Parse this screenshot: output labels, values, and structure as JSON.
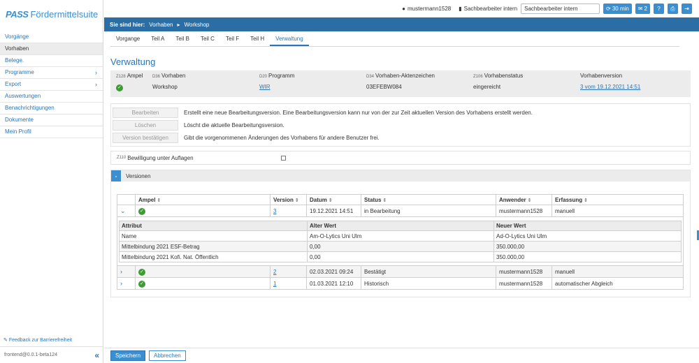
{
  "brand": {
    "pass": "PASS",
    "name": "Fördermittelsuite"
  },
  "sidebar": {
    "items": [
      {
        "label": "Vorgänge",
        "active": false,
        "chevron": false
      },
      {
        "label": "Vorhaben",
        "active": true,
        "chevron": false
      },
      {
        "label": "Belege.",
        "active": false,
        "chevron": false
      },
      {
        "label": "Programme",
        "active": false,
        "chevron": true
      },
      {
        "label": "Export",
        "active": false,
        "chevron": true
      },
      {
        "label": "Auswertungen",
        "active": false,
        "chevron": false
      },
      {
        "label": "Benachrichtigungen",
        "active": false,
        "chevron": false
      },
      {
        "label": "Dokumente",
        "active": false,
        "chevron": false
      },
      {
        "label": "Mein Profil",
        "active": false,
        "chevron": false
      }
    ],
    "feedback": "Feedback zur Barrierefreiheit",
    "version": "frontend@0.0.1-beta124"
  },
  "topbar": {
    "user": "mustermann1528",
    "role_label": "Sachbearbeiter intern",
    "role_select": "Sachbearbeiter intern",
    "session": "30 min",
    "messages": "2"
  },
  "breadcrumb": {
    "prefix": "Sie sind hier:",
    "items": [
      "Vorhaben",
      "Workshop"
    ]
  },
  "tabs": [
    "Vorgange",
    "Teil A",
    "Teil B",
    "Teil C",
    "Teil F",
    "Teil H",
    "Verwaltung"
  ],
  "page_title": "Verwaltung",
  "info": {
    "ampel": {
      "code": "Z128",
      "label": "Ampel"
    },
    "vorhaben": {
      "code": "D36",
      "label": "Vorhaben",
      "value": "Workshop"
    },
    "programm": {
      "code": "D20",
      "label": "Programm",
      "value": "WIR"
    },
    "aktenzeichen": {
      "code": "D34",
      "label": "Vorhaben-Aktenzeichen",
      "value": "03EFEBW084"
    },
    "status": {
      "code": "Z106",
      "label": "Vorhabenstatus",
      "value": "eingereicht"
    },
    "version": {
      "label": "Vorhabenversion",
      "value": "3 vom 19.12.2021 14:51"
    }
  },
  "actions": [
    {
      "button": "Bearbeiten",
      "desc": "Erstellt eine neue Bearbeitungsversion. Eine Bearbeitungsversion kann nur von der zur Zeit aktuellen Version des Vorhabens erstellt werden."
    },
    {
      "button": "Löschen",
      "desc": "Löscht die aktuelle Bearbeitungsversion."
    },
    {
      "button": "Version bestätigen",
      "desc": "Gibt die vorgenommenen Änderungen des Vorhabens für andere Benutzer frei."
    }
  ],
  "approval": {
    "code": "Z110",
    "label": "Bewilligung unter Auflagen"
  },
  "versions": {
    "title": "Versionen",
    "toggle": "-",
    "headers": [
      "Ampel",
      "Version",
      "Datum",
      "Status",
      "Anwender",
      "Erfassung"
    ],
    "rows": [
      {
        "version": "3",
        "datum": "19.12.2021 14:51",
        "status": "in Bearbeitung",
        "anwender": "mustermann1528",
        "erfassung": "manuell"
      },
      {
        "version": "2",
        "datum": "02.03.2021 09:24",
        "status": "Bestätigt",
        "anwender": "mustermann1528",
        "erfassung": "manuell"
      },
      {
        "version": "1",
        "datum": "01.03.2021 12:10",
        "status": "Historisch",
        "anwender": "mustermann1528",
        "erfassung": "automatischer Abgleich"
      }
    ],
    "detail": {
      "headers": [
        "Attribut",
        "Alter Wert",
        "Neuer Wert"
      ],
      "rows": [
        [
          "Name",
          "Am-O-Lytics Uni Ulm",
          "Ad-O-Lytics Uni Ulm"
        ],
        [
          "Mittelbindung 2021 ESF-Betrag",
          "0,00",
          "350.000,00"
        ],
        [
          "Mittelbindung 2021 Kofi. Nat. Öffentlich",
          "0,00",
          "350.000,00"
        ]
      ]
    }
  },
  "footer": {
    "save": "Speichern",
    "cancel": "Abbrechen"
  }
}
